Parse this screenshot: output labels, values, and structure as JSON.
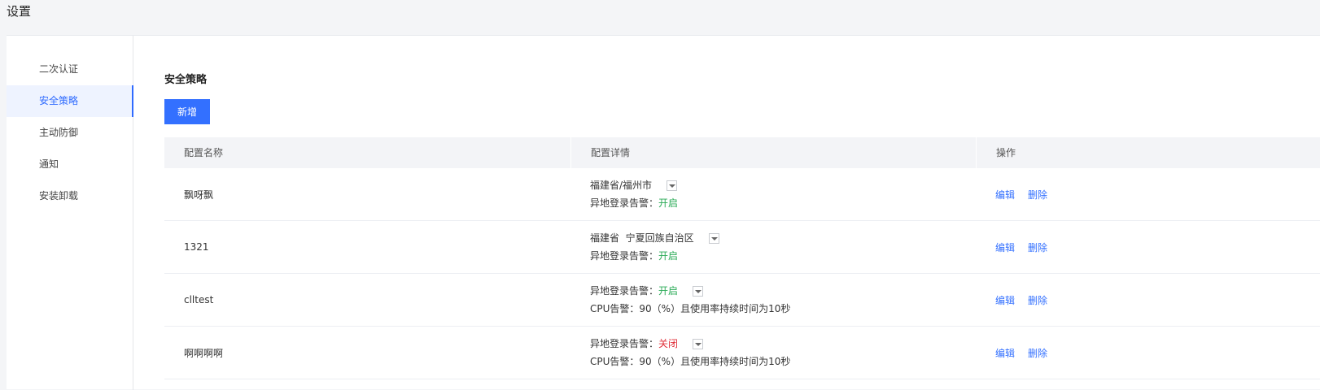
{
  "page": {
    "title": "设置"
  },
  "sidebar": {
    "items": [
      {
        "label": "二次认证",
        "active": false
      },
      {
        "label": "安全策略",
        "active": true
      },
      {
        "label": "主动防御",
        "active": false
      },
      {
        "label": "通知",
        "active": false
      },
      {
        "label": "安装卸载",
        "active": false
      }
    ]
  },
  "main": {
    "section_title": "安全策略",
    "add_label": "新增",
    "table": {
      "headers": [
        "配置名称",
        "配置详情",
        "操作"
      ],
      "rows": [
        {
          "name": "飘呀飘",
          "line1_text": "福建省/福州市",
          "line1_status": "",
          "line2_text": "异地登录告警：",
          "line2_status": "开启",
          "edit": "编辑",
          "delete": "删除"
        },
        {
          "name": "1321",
          "line1_text": "福建省  宁夏回族自治区",
          "line1_status": "",
          "line2_text": "异地登录告警：",
          "line2_status": "开启",
          "edit": "编辑",
          "delete": "删除"
        },
        {
          "name": "clltest",
          "line1_text": "异地登录告警：",
          "line1_status": "开启",
          "line2_text": "CPU告警：90（%）且使用率持续时间为10秒",
          "line2_status": "",
          "edit": "编辑",
          "delete": "删除"
        },
        {
          "name": "啊啊啊啊",
          "line1_text": "异地登录告警：",
          "line1_status": "关闭",
          "line2_text": "CPU告警：90（%）且使用率持续时间为10秒",
          "line2_status": "",
          "edit": "编辑",
          "delete": "删除"
        }
      ]
    }
  },
  "colors": {
    "accent": "#3370ff",
    "on": "#2bab57",
    "off": "#e0303a"
  }
}
